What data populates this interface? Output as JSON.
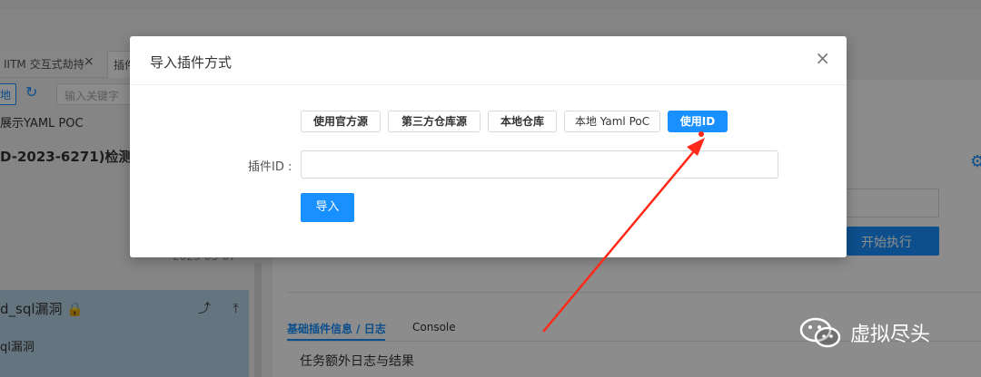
{
  "background": {
    "tabs": [
      {
        "label": "IITM 交互式劫持",
        "close": "×"
      },
      {
        "label": "插件"
      }
    ],
    "toolbar": {
      "location_button": "地",
      "refresh_icon": "refresh-icon",
      "search_placeholder": "输入关键字"
    },
    "yaml_link": "展示YAML POC",
    "plugin_title": "D-2023-6271)检测插",
    "date": "2023-05-07",
    "card": {
      "title": "d_sql漏洞 🔒",
      "icons": "⤴ ⤒",
      "subtitle": "ql漏洞"
    },
    "execute_button": "开始执行",
    "subtabs": [
      "基础插件信息 / 日志",
      "Console"
    ],
    "log_title": "任务额外日志与结果"
  },
  "modal": {
    "title": "导入插件方式",
    "close": "×",
    "sources": [
      {
        "label": "使用官方源",
        "active": false
      },
      {
        "label": "第三方仓库源",
        "active": false
      },
      {
        "label": "本地仓库",
        "active": false
      },
      {
        "label": "本地 Yaml PoC",
        "active": false
      },
      {
        "label": "使用ID",
        "active": true
      }
    ],
    "field_label": "插件ID :",
    "field_value": "",
    "import_button": "导入"
  },
  "watermark": {
    "text": "虚拟尽头"
  },
  "colors": {
    "primary": "#1890ff",
    "arrow": "#ff2a1a"
  }
}
